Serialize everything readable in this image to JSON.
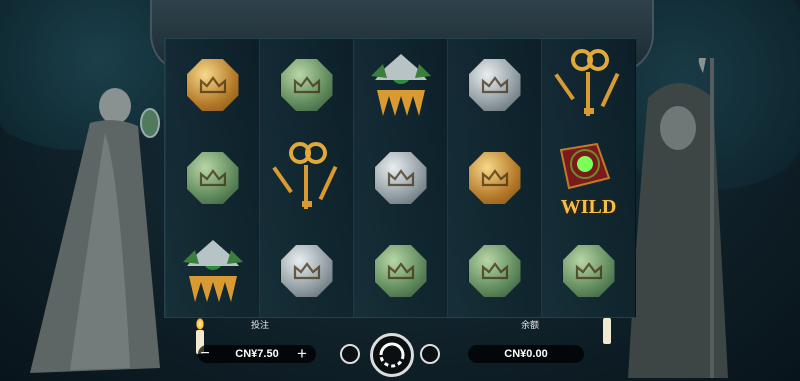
{
  "bet": {
    "label": "投注",
    "value": "CN¥7.50"
  },
  "balance": {
    "label": "余额",
    "value": "CN¥0.00"
  },
  "icons": {
    "minus": "minus-icon",
    "plus": "plus-icon",
    "spin": "spin-icon",
    "autoplay": "autoplay-icon",
    "settings": "settings-icon"
  },
  "wild_text": "WILD",
  "reels": [
    [
      "coin-gold",
      "coin-green",
      "hair-comb"
    ],
    [
      "coin-green",
      "keys",
      "coin-silver"
    ],
    [
      "hair-comb",
      "coin-silver",
      "coin-green"
    ],
    [
      "coin-silver",
      "coin-gold",
      "coin-green"
    ],
    [
      "keys",
      "wild-book",
      "coin-green"
    ]
  ]
}
